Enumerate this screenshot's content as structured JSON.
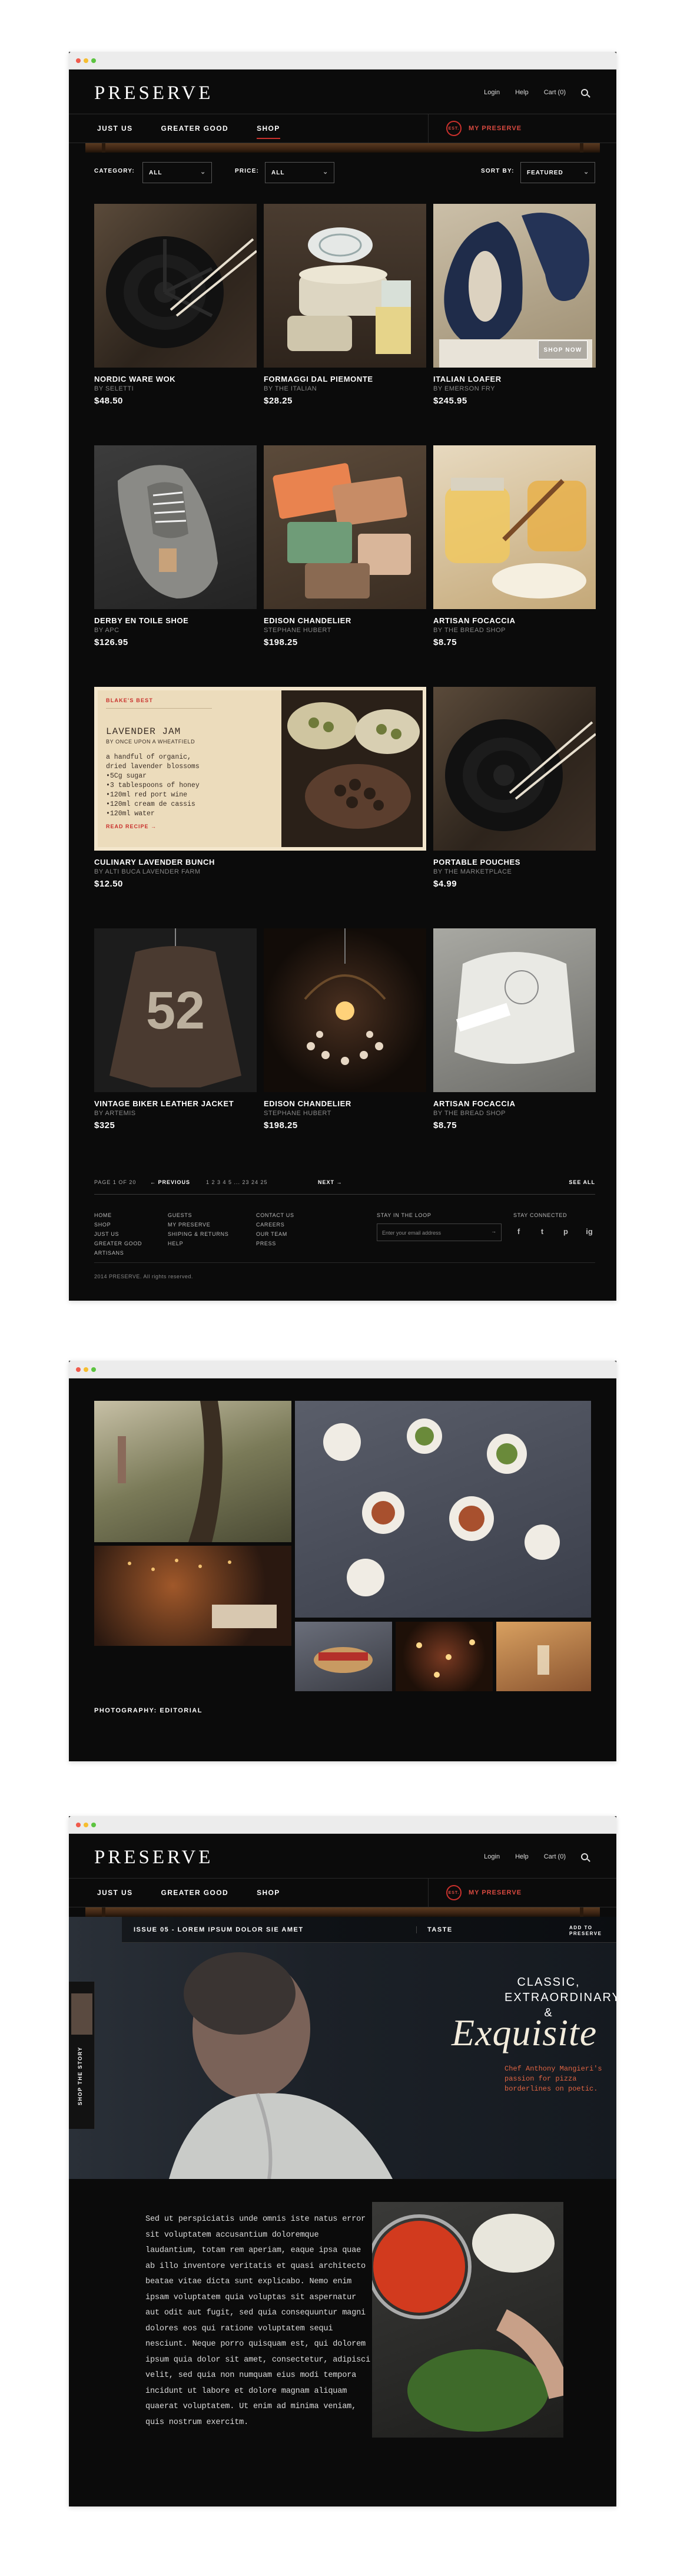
{
  "colors": {
    "accent": "#c9302c",
    "background": "#0b0b0b",
    "page": "#ffffff"
  },
  "brand": {
    "logo": "PRESERVE"
  },
  "header": {
    "login": "Login",
    "help": "Help",
    "cart": "Cart (0)",
    "nav": [
      "JUST US",
      "GREATER GOOD",
      "SHOP"
    ],
    "active_nav": "SHOP",
    "my_preserve": "MY PRESERVE",
    "badge": "EST."
  },
  "filters": {
    "category_label": "CATEGORY:",
    "category_value": "ALL",
    "price_label": "PRICE:",
    "price_value": "ALL",
    "sort_label": "SORT BY:",
    "sort_value": "FEATURED"
  },
  "products": [
    {
      "name": "NORDIC WARE WOK",
      "by": "BY SELETTI",
      "price": "$48.50"
    },
    {
      "name": "FORMAGGI DAL PIEMONTE",
      "by": "BY THE ITALIAN",
      "price": "$28.25"
    },
    {
      "name": "ITALIAN LOAFER",
      "by": "BY EMERSON FRY",
      "price": "$245.95",
      "cta": "SHOP NOW"
    },
    {
      "name": "DERBY EN TOILE SHOE",
      "by": "BY APC",
      "price": "$126.95"
    },
    {
      "name": "EDISON CHANDELIER",
      "by": "STEPHANE HUBERT",
      "price": "$198.25"
    },
    {
      "name": "ARTISAN FOCACCIA",
      "by": "BY THE BREAD SHOP",
      "price": "$8.75"
    },
    {
      "name": "CULINARY LAVENDER BUNCH",
      "by": "BY ALTI BUCA LAVENDER FARM",
      "price": "$12.50"
    },
    {
      "name": "PORTABLE POUCHES",
      "by": "BY THE MARKETPLACE",
      "price": "$4.99"
    },
    {
      "name": "VINTAGE BIKER LEATHER JACKET",
      "by": "BY ARTEMIS",
      "price": "$325"
    },
    {
      "name": "EDISON CHANDELIER",
      "by": "STEPHANE HUBERT",
      "price": "$198.25"
    },
    {
      "name": "ARTISAN FOCACCIA",
      "by": "BY THE BREAD SHOP",
      "price": "$8.75"
    }
  ],
  "recipe": {
    "tag": "BLAKE'S BEST",
    "title": "LAVENDER JAM",
    "subtitle": "BY ONCE UPON A WHEATFIELD",
    "lines": [
      "a handful of organic,",
      "dried lavender blossoms",
      "•5Cg sugar",
      "•3 tablespoons of honey",
      "•120ml red port wine",
      "•120ml cream de cassis",
      "•120ml water"
    ],
    "link": "READ RECIPE →"
  },
  "pagination": {
    "info": "PAGE 1 OF 20",
    "prev": "← PREVIOUS",
    "pages": "1  2  3  4  5  ...  23  24  25",
    "next": "NEXT →",
    "see_all": "SEE ALL"
  },
  "footer": {
    "col1": [
      "HOME",
      "SHOP",
      "JUST US",
      "GREATER GOOD",
      "ARTISANS"
    ],
    "col2": [
      "GUESTS",
      "MY PRESERVE",
      "SHIPING & RETURNS",
      "HELP"
    ],
    "col3": [
      "CONTACT US",
      "CAREERS",
      "OUR TEAM",
      "PRESS"
    ],
    "loop_title": "STAY IN THE LOOP",
    "email_placeholder": "Enter your email address",
    "connected_title": "STAY CONNECTED",
    "social": [
      "f",
      "t",
      "p",
      "ig"
    ],
    "copyright": "2014 PRESERVE. All rights reserved."
  },
  "gallery": {
    "caption": "PHOTOGRAPHY: EDITORIAL"
  },
  "story": {
    "issue": "ISSUE 05 - LOREM IPSUM DOLOR SIE AMET",
    "taste": "TASTE",
    "add": "ADD TO PRESERVE",
    "side": "SHOP THE STORY",
    "headline": "CLASSIC, EXTRAORDINARY &",
    "script": "Exquisite",
    "chef_note": "Chef Anthony Mangieri's passion for pizza borderlines on poetic.",
    "body": "Sed ut perspiciatis unde omnis iste natus error sit voluptatem accusantium doloremque laudantium, totam rem aperiam, eaque ipsa quae ab illo inventore veritatis et quasi architecto beatae vitae dicta sunt explicabo. Nemo enim ipsam voluptatem quia voluptas sit aspernatur aut odit aut fugit, sed quia consequuntur magni dolores eos qui ratione voluptatem sequi nesciunt. Neque porro quisquam est, qui dolorem ipsum quia dolor sit amet, consectetur, adipisci velit, sed quia non numquam eius modi tempora incidunt ut labore et dolore magnam aliquam quaerat voluptatem. Ut enim ad minima veniam, quis nostrum exercitm."
  }
}
